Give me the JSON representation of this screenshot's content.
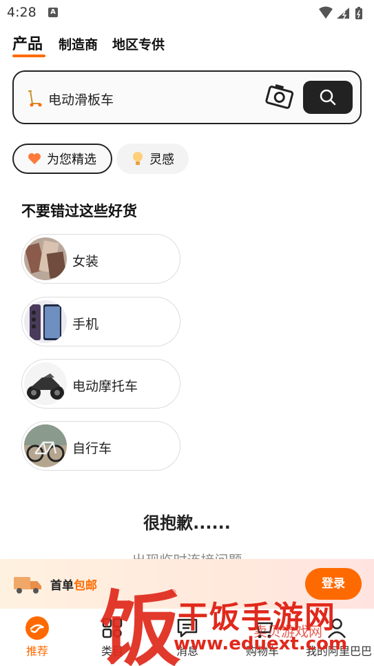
{
  "status_bar": {
    "time": "4:28",
    "notification_badge": "A"
  },
  "tabs": [
    {
      "label": "产品",
      "active": true
    },
    {
      "label": "制造商",
      "active": false
    },
    {
      "label": "地区专供",
      "active": false
    }
  ],
  "search": {
    "value": "电动滑板车"
  },
  "filter_chips": [
    {
      "label": "为您精选",
      "icon": "heart-icon",
      "selected": true
    },
    {
      "label": "灵感",
      "icon": "lightbulb-icon",
      "selected": false
    }
  ],
  "section": {
    "title": "不要错过这些好货"
  },
  "categories": [
    {
      "label": "女装",
      "thumb": "clothing-thumb"
    },
    {
      "label": "手机",
      "thumb": "phone-thumb"
    },
    {
      "label": "电动摩托车",
      "thumb": "motorcycle-thumb"
    },
    {
      "label": "自行车",
      "thumb": "bicycle-thumb"
    }
  ],
  "error": {
    "title": "很抱歉......",
    "subtitle": "出现临时连接问题"
  },
  "promo": {
    "prefix": "首单",
    "accent": "包邮",
    "login_label": "登录"
  },
  "bottom_nav": [
    {
      "label": "推荐",
      "icon": "alibaba-home-icon",
      "active": true
    },
    {
      "label": "类目",
      "icon": "category-icon",
      "active": false
    },
    {
      "label": "消息",
      "icon": "message-icon",
      "active": false
    },
    {
      "label": "购物车",
      "icon": "cart-icon",
      "active": false
    },
    {
      "label": "我的阿里巴巴",
      "icon": "profile-icon",
      "active": false
    }
  ],
  "watermark": {
    "brand": "干饭手游网",
    "url": "www.eduext.com",
    "overlay": "卖贝游戏网",
    "glyph": "饭"
  },
  "colors": {
    "accent": "#ff6a00",
    "dark": "#222222",
    "watermark": "#e0291c"
  }
}
